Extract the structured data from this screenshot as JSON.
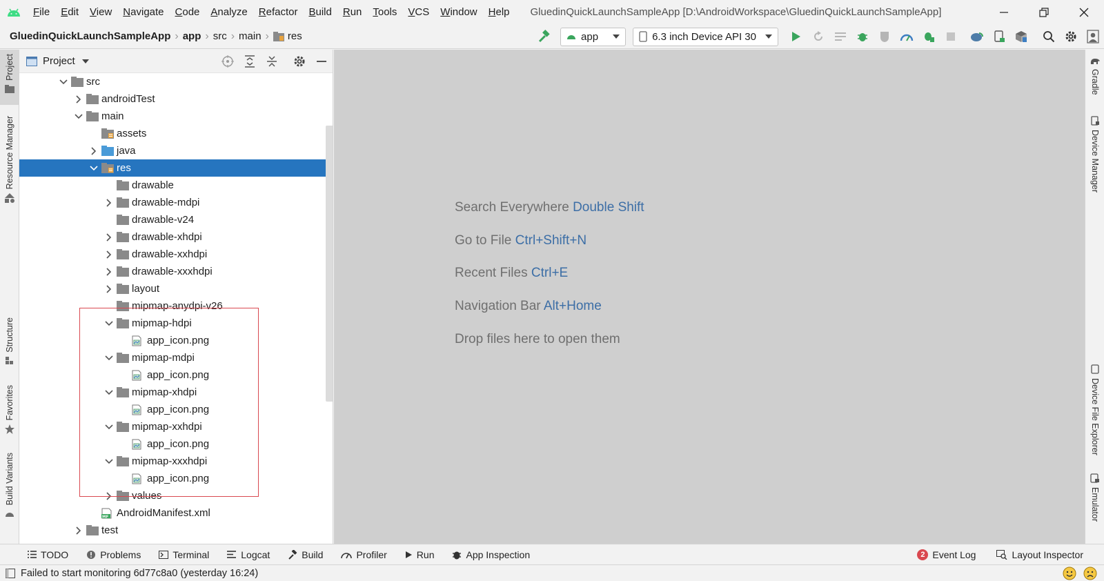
{
  "menubar": {
    "items": [
      "File",
      "Edit",
      "View",
      "Navigate",
      "Code",
      "Analyze",
      "Refactor",
      "Build",
      "Run",
      "Tools",
      "VCS",
      "Window",
      "Help"
    ],
    "window_title": "GluedinQuickLaunchSampleApp [D:\\AndroidWorkspace\\GluedinQuickLaunchSampleApp]"
  },
  "breadcrumbs": [
    "GluedinQuickLaunchSampleApp",
    "app",
    "src",
    "main",
    "res"
  ],
  "toolbar": {
    "run_config": "app",
    "device": "6.3 inch Device API 30"
  },
  "project_panel": {
    "title": "Project",
    "tree": [
      {
        "label": "src",
        "type": "folder",
        "expanded": true
      },
      {
        "label": "androidTest",
        "type": "folder",
        "expanded": false
      },
      {
        "label": "main",
        "type": "folder",
        "expanded": true
      },
      {
        "label": "assets",
        "type": "assets-folder",
        "expanded": null
      },
      {
        "label": "java",
        "type": "source-folder",
        "expanded": false
      },
      {
        "label": "res",
        "type": "res-folder",
        "expanded": true
      },
      {
        "label": "drawable",
        "type": "folder",
        "expanded": null
      },
      {
        "label": "drawable-mdpi",
        "type": "folder",
        "expanded": false
      },
      {
        "label": "drawable-v24",
        "type": "folder",
        "expanded": null
      },
      {
        "label": "drawable-xhdpi",
        "type": "folder",
        "expanded": false
      },
      {
        "label": "drawable-xxhdpi",
        "type": "folder",
        "expanded": false
      },
      {
        "label": "drawable-xxxhdpi",
        "type": "folder",
        "expanded": false
      },
      {
        "label": "layout",
        "type": "folder",
        "expanded": false
      },
      {
        "label": "mipmap-anydpi-v26",
        "type": "folder",
        "expanded": null
      },
      {
        "label": "mipmap-hdpi",
        "type": "folder",
        "expanded": true
      },
      {
        "label": "app_icon.png",
        "type": "image-file",
        "expanded": null
      },
      {
        "label": "mipmap-mdpi",
        "type": "folder",
        "expanded": true
      },
      {
        "label": "app_icon.png",
        "type": "image-file",
        "expanded": null
      },
      {
        "label": "mipmap-xhdpi",
        "type": "folder",
        "expanded": true
      },
      {
        "label": "app_icon.png",
        "type": "image-file",
        "expanded": null
      },
      {
        "label": "mipmap-xxhdpi",
        "type": "folder",
        "expanded": true
      },
      {
        "label": "app_icon.png",
        "type": "image-file",
        "expanded": null
      },
      {
        "label": "mipmap-xxxhdpi",
        "type": "folder",
        "expanded": true
      },
      {
        "label": "app_icon.png",
        "type": "image-file",
        "expanded": null
      },
      {
        "label": "values",
        "type": "folder",
        "expanded": false
      },
      {
        "label": "AndroidManifest.xml",
        "type": "manifest-file",
        "expanded": null
      },
      {
        "label": "test",
        "type": "folder",
        "expanded": false
      }
    ]
  },
  "left_tabs": [
    "Project",
    "Resource Manager",
    "Structure",
    "Favorites",
    "Build Variants"
  ],
  "right_tabs": [
    "Gradle",
    "Device Manager",
    "Device File Explorer",
    "Emulator"
  ],
  "editor_hints": [
    {
      "text": "Search Everywhere",
      "key": "Double Shift"
    },
    {
      "text": "Go to File",
      "key": "Ctrl+Shift+N"
    },
    {
      "text": "Recent Files",
      "key": "Ctrl+E"
    },
    {
      "text": "Navigation Bar",
      "key": "Alt+Home"
    },
    {
      "text": "Drop files here to open them",
      "key": ""
    }
  ],
  "bottom_tabs": [
    "TODO",
    "Problems",
    "Terminal",
    "Logcat",
    "Build",
    "Profiler",
    "Run",
    "App Inspection"
  ],
  "bottom_right_tabs": {
    "event_log": "Event Log",
    "event_count": "2",
    "layout_inspector": "Layout Inspector"
  },
  "status": {
    "message": "Failed to start monitoring 6d77c8a0 (yesterday 16:24)"
  },
  "colors": {
    "selection": "#2675bf",
    "highlight_box": "#d9484f",
    "hint_key": "#3c6ea6",
    "run_green": "#3aa55d"
  }
}
